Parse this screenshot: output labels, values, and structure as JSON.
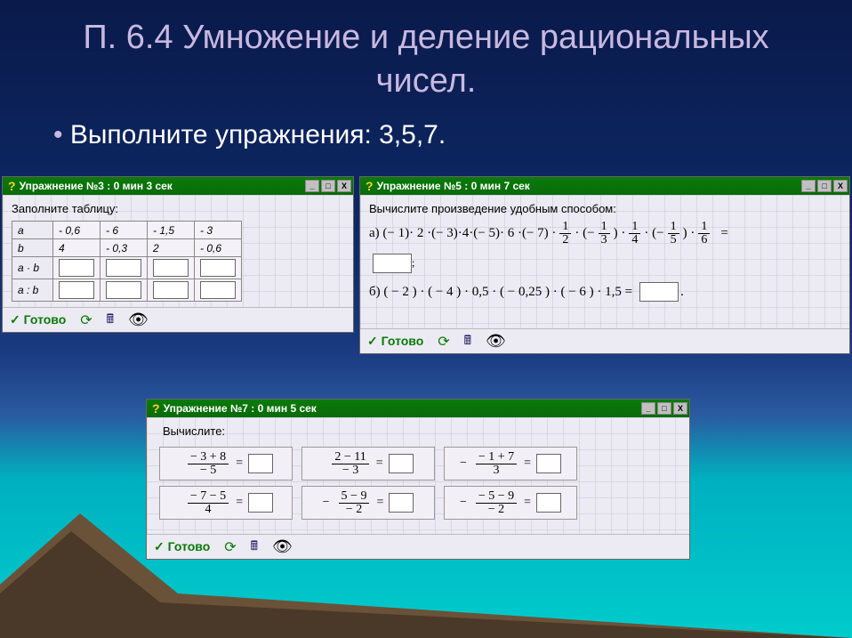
{
  "slide": {
    "title": "П. 6.4 Умножение и деление рациональных чисел.",
    "bullet": "Выполните упражнения: 3,5,7."
  },
  "ex3": {
    "title": "Упражнение №3 : 0 мин  3 сек",
    "prompt": "Заполните таблицу:",
    "rows": {
      "r0": {
        "h": "a",
        "c1": "- 0,6",
        "c2": "- 6",
        "c3": "- 1,5",
        "c4": "- 3"
      },
      "r1": {
        "h": "b",
        "c1": "4",
        "c2": "- 0,3",
        "c3": "2",
        "c4": "- 0,6"
      },
      "r2": {
        "h": "a · b"
      },
      "r3": {
        "h": "a : b"
      }
    }
  },
  "ex5": {
    "title": "Упражнение №5 : 0 мин  7 сек",
    "prompt": "Вычислите произведение удобным способом:",
    "line_a_prefix": "а)   (− 1)· 2 ·(− 3)·4·(− 5)· 6 ·(− 7) ·",
    "fracs": {
      "f1n": "1",
      "f1d": "2",
      "f2n": "1",
      "f2d": "3",
      "f3n": "1",
      "f3d": "4",
      "f4n": "1",
      "f4d": "5",
      "f5n": "1",
      "f5d": "6"
    },
    "eq": "=",
    "line_b": "б)   ( − 2 ) · ( − 4 ) · 0,5 · ( − 0,25 ) · ( − 6 ) · 1,5 ="
  },
  "ex7": {
    "title": "Упражнение №7 : 0 мин  5 сек",
    "prompt": "Вычислите:",
    "cells": {
      "c0": {
        "pre": "",
        "num": "− 3 + 8",
        "den": "− 5"
      },
      "c1": {
        "pre": "",
        "num": "2 − 11",
        "den": "− 3"
      },
      "c2": {
        "pre": "−",
        "num": "− 1 + 7",
        "den": "3"
      },
      "c3": {
        "pre": "",
        "num": "− 7 − 5",
        "den": "4"
      },
      "c4": {
        "pre": "−",
        "num": "5 − 9",
        "den": "− 2"
      },
      "c5": {
        "pre": "−",
        "num": "− 5 − 9",
        "den": "− 2"
      }
    }
  },
  "toolbar": {
    "ready": "Готово"
  },
  "winbtns": {
    "min": "_",
    "max": "□",
    "close": "X"
  }
}
